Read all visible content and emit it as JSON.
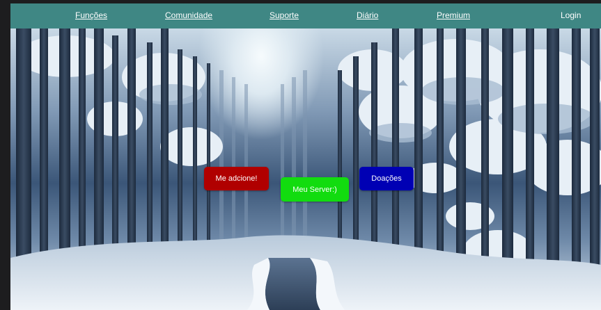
{
  "nav": {
    "items": [
      {
        "label": "Funções"
      },
      {
        "label": "Comunidade"
      },
      {
        "label": "Suporte"
      },
      {
        "label": "Diário"
      },
      {
        "label": "Premium"
      }
    ],
    "login_label": "Login"
  },
  "hero": {
    "background": "snowy-forest-image"
  },
  "buttons": {
    "add_me": {
      "label": "Me adcione!",
      "color": "#b00000"
    },
    "my_server": {
      "label": "Meu Server:)",
      "color": "#12dc0f"
    },
    "donations": {
      "label": "Doações",
      "color": "#0000b4"
    }
  },
  "colors": {
    "nav_bar": "#3f8784",
    "page_background": "#1d1d1f"
  }
}
